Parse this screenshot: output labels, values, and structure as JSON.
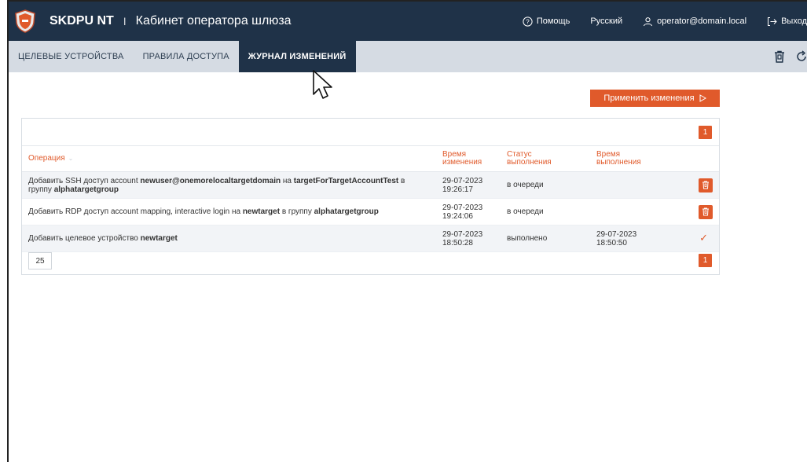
{
  "header": {
    "brand": "SKDPU NT",
    "separator": "I",
    "title": "Кабинет оператора шлюза",
    "help": "Помощь",
    "language": "Русский",
    "user": "operator@domain.local",
    "logout": "Выход"
  },
  "tabs": [
    {
      "label": "ЦЕЛЕВЫЕ УСТРОЙСТВА"
    },
    {
      "label": "ПРАВИЛА ДОСТУПА"
    },
    {
      "label": "ЖУРНАЛ ИЗМЕНЕНИЙ"
    }
  ],
  "actions": {
    "apply": "Применить изменения"
  },
  "pagination": {
    "page": "1",
    "page_size": "25"
  },
  "table": {
    "columns": {
      "operation": "Операция",
      "changed": [
        "Время",
        "изменения"
      ],
      "status": [
        "Статус",
        "выполнения"
      ],
      "executed": [
        "Время",
        "выполнения"
      ]
    },
    "rows": [
      {
        "op_parts": [
          "Добавить SSH доступ account ",
          "newuser@onemorelocaltargetdomain",
          " на ",
          "targetForTargetAccountTest",
          " в группу ",
          "alphatargetgroup"
        ],
        "changed_date": "29-07-2023",
        "changed_time": "19:26:17",
        "status": "в очереди",
        "exec_date": "",
        "exec_time": ""
      },
      {
        "op_parts": [
          "Добавить RDP доступ account mapping, interactive login на ",
          "newtarget",
          " в группу ",
          "alphatargetgroup",
          "",
          ""
        ],
        "changed_date": "29-07-2023",
        "changed_time": "19:24:06",
        "status": "в очереди",
        "exec_date": "",
        "exec_time": ""
      },
      {
        "op_parts": [
          "Добавить целевое устройство ",
          "newtarget",
          "",
          "",
          "",
          ""
        ],
        "changed_date": "29-07-2023",
        "changed_time": "18:50:28",
        "status": "выполнено",
        "exec_date": "29-07-2023",
        "exec_time": "18:50:50"
      }
    ]
  },
  "colors": {
    "navy": "#1f3248",
    "accent": "#e05a2b",
    "tabbar": "#d5dbe3"
  },
  "icons": [
    "shield-logo-icon",
    "help-circle-icon",
    "user-icon",
    "logout-arrow-icon",
    "trash-icon",
    "refresh-icon",
    "check-icon",
    "apply-arrow-icon",
    "sort-icon"
  ]
}
